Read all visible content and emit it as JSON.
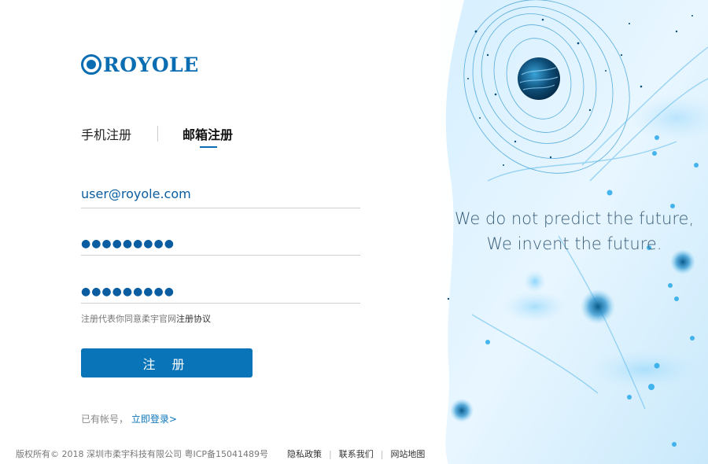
{
  "brand": {
    "logo_text": "ROYOLE"
  },
  "tabs": [
    {
      "label": "手机注册",
      "active": false
    },
    {
      "label": "邮箱注册",
      "active": true
    }
  ],
  "form": {
    "email_value": "user@royole.com",
    "password_mask": "●●●●●●●●●",
    "confirm_password_mask": "●●●●●●●●●",
    "agreement_prefix": "注册代表你同意柔宇官网",
    "agreement_link": "注册协议",
    "submit_label": "注 册"
  },
  "login_hint": {
    "text": "已有帐号，",
    "link": "立即登录>"
  },
  "footer": {
    "copyright": "版权所有© 2018 深圳市柔宇科技有限公司 粤ICP备15041489号",
    "links": [
      "隐私政策",
      "联系我们",
      "网站地图"
    ]
  },
  "hero": {
    "line1": "We do not predict the future,",
    "line2": "We invent the future.",
    "accent_color": "#1a9be0"
  },
  "colors": {
    "primary": "#0a74b9",
    "logo": "#0a6cb1"
  }
}
